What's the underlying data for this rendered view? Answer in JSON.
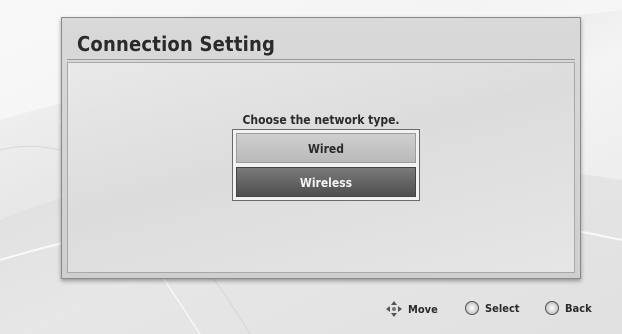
{
  "dialog": {
    "title": "Connection Setting",
    "prompt": "Choose the network type.",
    "options": [
      {
        "label": "Wired",
        "selected": false
      },
      {
        "label": "Wireless",
        "selected": true
      }
    ]
  },
  "footer": {
    "move_label": "Move",
    "select_label": "Select",
    "back_label": "Back",
    "icons": {
      "move": "directional-arrows-icon",
      "select": "circle-button-icon",
      "back": "circle-button-icon"
    }
  }
}
